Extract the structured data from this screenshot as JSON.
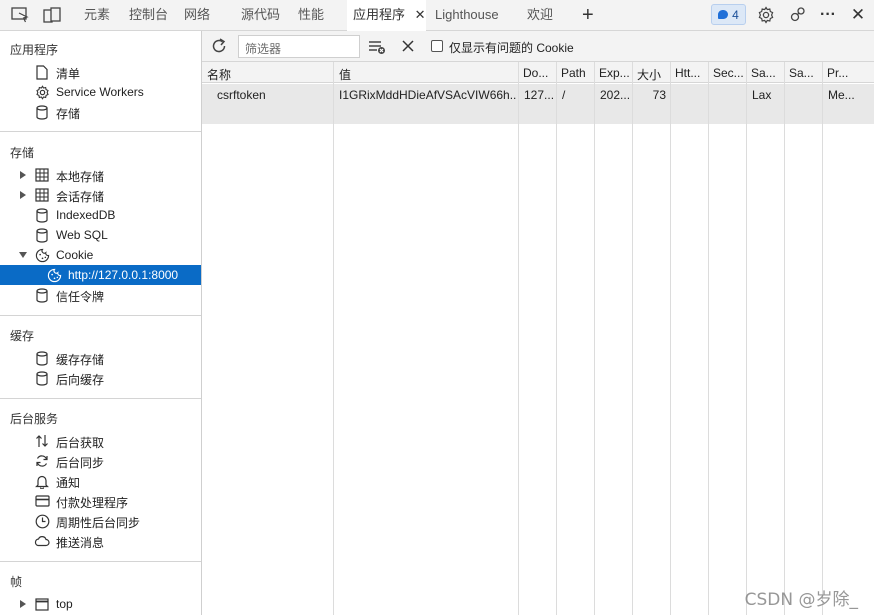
{
  "tabs": {
    "elements": "元素",
    "console": "控制台",
    "network": "网络",
    "sources": "源代码",
    "performance": "性能",
    "application": "应用程序",
    "application_close": "✕",
    "lighthouse": "Lighthouse",
    "welcome": "欢迎",
    "add": "+"
  },
  "toolbar_right": {
    "issues_count": "4",
    "more": "···",
    "close": "✕"
  },
  "sidebar": {
    "app_section": {
      "title": "应用程序",
      "items": [
        {
          "label": "清单",
          "icon": "document-icon"
        },
        {
          "label": "Service Workers",
          "icon": "gear-icon"
        },
        {
          "label": "存储",
          "icon": "database-icon"
        }
      ]
    },
    "storage_section": {
      "title": "存储",
      "items": [
        {
          "label": "本地存储",
          "icon": "grid-icon"
        },
        {
          "label": "会话存储",
          "icon": "grid-icon"
        },
        {
          "label": "IndexedDB",
          "icon": "database-icon"
        },
        {
          "label": "Web SQL",
          "icon": "database-icon"
        },
        {
          "label": "Cookie",
          "icon": "cookie-icon"
        },
        {
          "label": "http://127.0.0.1:8000",
          "icon": "cookie-icon"
        },
        {
          "label": "信任令牌",
          "icon": "database-icon"
        }
      ]
    },
    "cache_section": {
      "title": "缓存",
      "items": [
        {
          "label": "缓存存储",
          "icon": "database-icon"
        },
        {
          "label": "后向缓存",
          "icon": "database-icon"
        }
      ]
    },
    "background_section": {
      "title": "后台服务",
      "items": [
        {
          "label": "后台获取",
          "icon": "arrows-up-down-icon"
        },
        {
          "label": "后台同步",
          "icon": "sync-icon"
        },
        {
          "label": "通知",
          "icon": "bell-icon"
        },
        {
          "label": "付款处理程序",
          "icon": "card-icon"
        },
        {
          "label": "周期性后台同步",
          "icon": "clock-icon"
        },
        {
          "label": "推送消息",
          "icon": "cloud-icon"
        }
      ]
    },
    "frames_section": {
      "title": "帧",
      "items": [
        {
          "label": "top",
          "icon": "window-icon"
        }
      ]
    }
  },
  "filter": {
    "placeholder": "筛选器"
  },
  "only_issues_label": "仅显示有问题的 Cookie",
  "table": {
    "headers": [
      "名称",
      "值",
      "Do...",
      "Path",
      "Exp...",
      "大小",
      "Htt...",
      "Sec...",
      "Sa...",
      "Sa...",
      "Pr..."
    ],
    "rows": [
      [
        "csrftoken",
        "I1GRixMddHDieAfVSAcVIW66h...",
        "127...",
        "/",
        "202...",
        "73",
        "",
        "",
        "Lax",
        "",
        "Me..."
      ]
    ]
  },
  "watermark": "CSDN @岁除_"
}
